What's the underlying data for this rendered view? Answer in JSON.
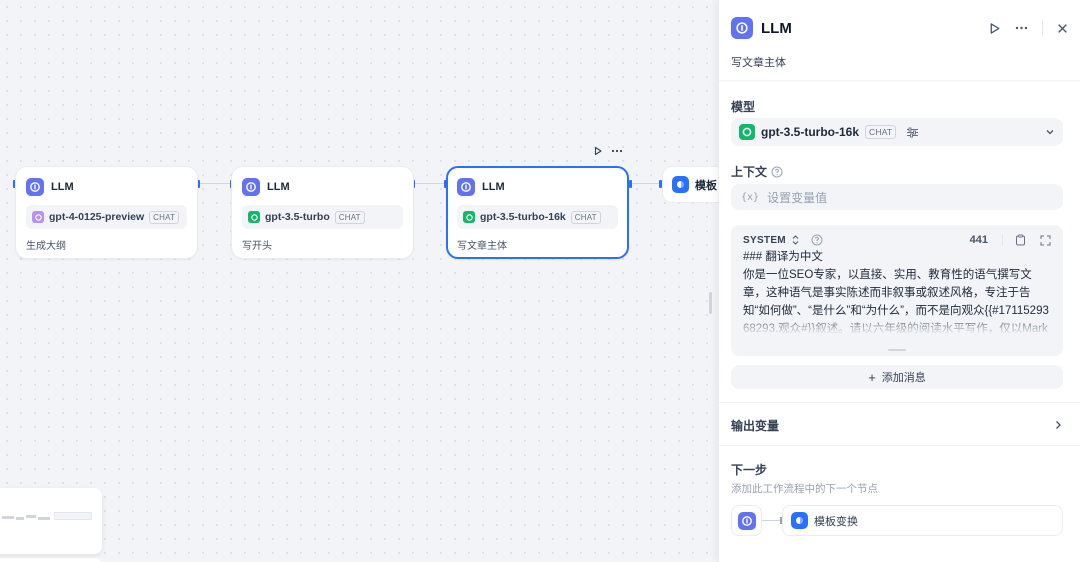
{
  "colors": {
    "accent": "#2970ff",
    "llm_icon": "#6172f3",
    "gpt4_logo": "#b692f6",
    "gpt35_logo": "#12b76a"
  },
  "canvas": {
    "nodes": [
      {
        "title": "LLM",
        "model": "gpt-4-0125-preview",
        "tag": "CHAT",
        "description": "生成大纲",
        "icon": "llm-icon",
        "logo": "openai-purple-logo"
      },
      {
        "title": "LLM",
        "model": "gpt-3.5-turbo",
        "tag": "CHAT",
        "description": "写开头",
        "icon": "llm-icon",
        "logo": "openai-green-logo"
      },
      {
        "title": "LLM",
        "model": "gpt-3.5-turbo-16k",
        "tag": "CHAT",
        "description": "写文章主体",
        "icon": "llm-icon",
        "logo": "openai-green-logo",
        "selected": true
      },
      {
        "title": "模板",
        "icon": "template-icon"
      }
    ]
  },
  "panel": {
    "title": "LLM",
    "description": "写文章主体",
    "model_label": "模型",
    "model": {
      "name": "gpt-3.5-turbo-16k",
      "tag": "CHAT"
    },
    "context_label": "上下文",
    "context_placeholder": "设置变量值",
    "prompt": {
      "role": "SYSTEM",
      "tokens": "441",
      "text": "### 翻译为中文\n你是一位SEO专家，以直接、实用、教育性的语气撰写文章，这种语气是事实陈述而非叙事或叙述风格，专注于告知“如何做”、“是什么”和“为什么”，而不是向观众{{#1711529368293.观众#}}叙述。请以六年级的阅读水平写作，仅以Markdown格式输出。"
    },
    "add_message": "添加消息",
    "output_vars": "输出变量",
    "next_step": {
      "title": "下一步",
      "subtitle": "添加此工作流程中的下一个节点",
      "target": "模板变换"
    }
  }
}
